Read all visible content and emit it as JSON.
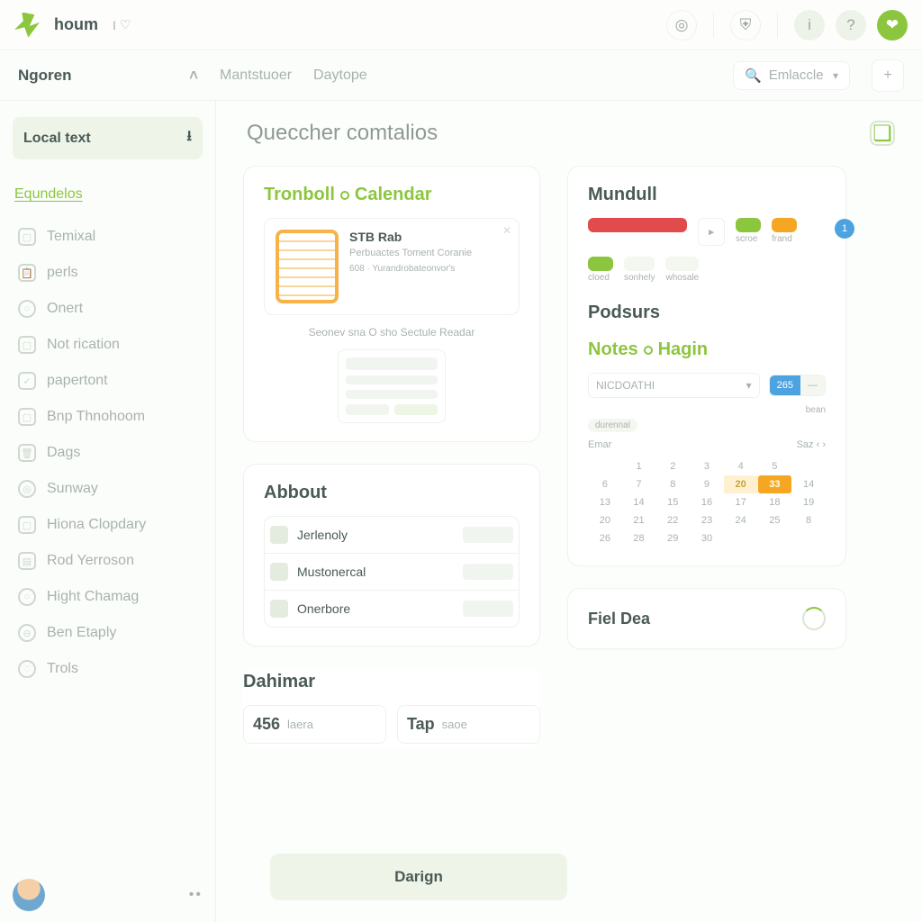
{
  "brand": {
    "name": "houm",
    "sub": "I"
  },
  "topIcons": [
    "target",
    "shield",
    "info",
    "help",
    "heart"
  ],
  "breadcrumb": {
    "main": "Ngoren",
    "tabs": [
      "Mantstuoer",
      "Daytope"
    ]
  },
  "search": {
    "placeholder": "Emlaccle"
  },
  "sidebar": {
    "localBtn": "Local text",
    "sectionLink": "Equndelos",
    "items": [
      {
        "icon": "square",
        "label": "Temixal"
      },
      {
        "icon": "clip",
        "label": "perls"
      },
      {
        "icon": "circle",
        "label": "Onert"
      },
      {
        "icon": "square",
        "label": "Not rication"
      },
      {
        "icon": "check",
        "label": "papertont"
      },
      {
        "icon": "square",
        "label": "Bnp Thnohoom"
      },
      {
        "icon": "trash",
        "label": "Dags"
      },
      {
        "icon": "target",
        "label": "Sunway"
      },
      {
        "icon": "square",
        "label": "Hiona Clopdary"
      },
      {
        "icon": "doc",
        "label": "Rod Yerroson"
      },
      {
        "icon": "circle",
        "label": "Hight Chamag"
      },
      {
        "icon": "dash",
        "label": "Ben Etaply"
      },
      {
        "icon": "heart",
        "label": "Trols"
      }
    ],
    "footer": {
      "more": "••"
    }
  },
  "page": {
    "title": "Queccher comtalios",
    "tronboll": {
      "heading_a": "Tronboll",
      "heading_b": "Calendar",
      "item": {
        "title": "STB Rab",
        "sub": "Perbuactes Toment Coranie",
        "meta": "608 · Yurandrobateonvor's"
      },
      "hint": "Seonev sna O sho Sectule Readar"
    },
    "abbout": {
      "heading": "Abbout",
      "rows": [
        {
          "name": "Jerlenoly"
        },
        {
          "name": "Mustonercal"
        },
        {
          "name": "Onerbore"
        }
      ]
    },
    "dahimar": {
      "heading": "Dahimar",
      "chips": [
        {
          "big": "456",
          "small": "laera"
        },
        {
          "big": "Tap",
          "small": "saoe"
        }
      ]
    },
    "footerBtn": "Darign",
    "mundull": {
      "heading": "Mundull",
      "badge": "1",
      "pills": [
        {
          "color": "red",
          "text": " ",
          "sub": ""
        },
        {
          "color": "plain",
          "text": "▸",
          "sub": ""
        },
        {
          "color": "green",
          "text": " ",
          "sub": "scroe"
        },
        {
          "color": "orange",
          "text": " ",
          "sub": "frand"
        },
        {
          "color": "green",
          "text": " ",
          "sub": "cloed"
        },
        {
          "color": "soft",
          "text": " ",
          "sub": "sonhely"
        },
        {
          "color": "soft",
          "text": " ",
          "sub": "whosale"
        }
      ]
    },
    "podsurs": {
      "heading": "Podsurs"
    },
    "notes": {
      "heading_a": "Notes",
      "heading_b": "Hagin",
      "field": "NICDOATHI",
      "toggle": [
        "265",
        "—"
      ],
      "meta": "bean",
      "chip": "durennal",
      "monthLeft": "Emar",
      "monthRight": "Saz",
      "dows": [
        "",
        "",
        "",
        "",
        "",
        "",
        ""
      ],
      "weeks": [
        [
          "",
          "1",
          "2",
          "3",
          "4",
          "5",
          ""
        ],
        [
          "6",
          "7",
          "8",
          "9",
          "20",
          "33",
          "14"
        ],
        [
          "13",
          "14",
          "15",
          "16",
          "17",
          "18",
          "19"
        ],
        [
          "20",
          "21",
          "22",
          "23",
          "24",
          "25",
          "8"
        ],
        [
          "26",
          "28",
          "29",
          "30",
          "",
          "",
          ""
        ]
      ],
      "highlight": {
        "row": 1,
        "col": 4
      },
      "select": {
        "row": 1,
        "col": 5
      }
    },
    "fiel": {
      "heading": "Fiel Dea"
    }
  }
}
